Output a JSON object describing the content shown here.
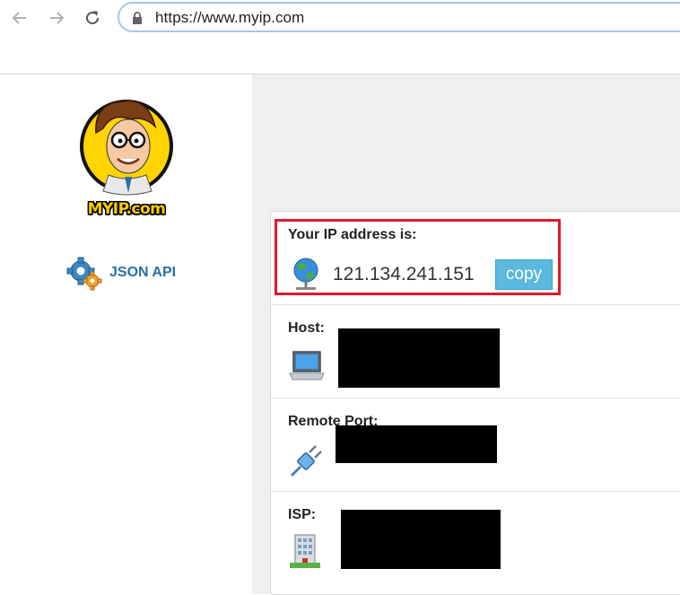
{
  "browser": {
    "url": "https://www.myip.com"
  },
  "sidebar": {
    "logo_text": "MYIP.com",
    "json_api_label": "JSON API"
  },
  "panel": {
    "ip_label": "Your IP address is:",
    "ip_value": "121.134.241.151",
    "copy_label": "copy",
    "host_label": "Host:",
    "port_label": "Remote Port:",
    "isp_label": "ISP:"
  },
  "colors": {
    "highlight_border": "#e0182a",
    "copy_button": "#5bb8de",
    "link": "#2a6fa8",
    "content_background": "#efefef"
  },
  "icons": [
    "back-arrow-icon",
    "forward-arrow-icon",
    "reload-icon",
    "lock-icon",
    "globe-icon",
    "laptop-icon",
    "plug-icon",
    "building-icon",
    "gear-icon"
  ]
}
